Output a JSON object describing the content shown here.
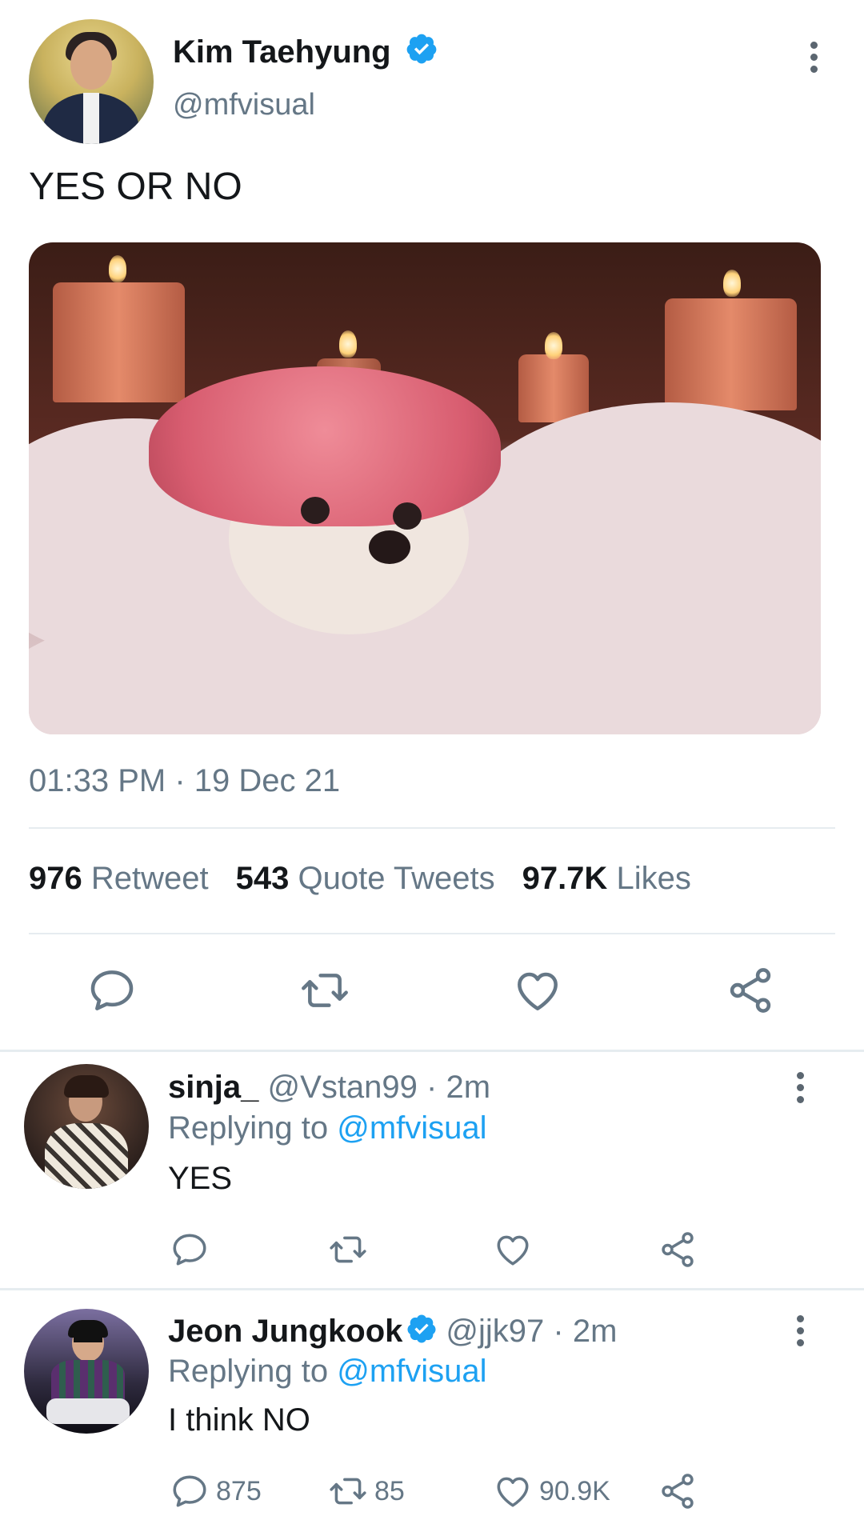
{
  "tweet": {
    "author": {
      "name": "Kim Taehyung",
      "handle": "@mfvisual",
      "verified": true
    },
    "text": "YES OR NO",
    "image_alt": "chihuahua wearing a pink shower cap in a bubble bath with candles",
    "timestamp": "01:33 PM · 19 Dec 21",
    "stats": {
      "retweets_count": "976",
      "retweets_label": "Retweet",
      "quotes_count": "543",
      "quotes_label": "Quote Tweets",
      "likes_count": "97.7K",
      "likes_label": "Likes"
    },
    "actions": [
      "reply-icon",
      "retweet-icon",
      "like-icon",
      "share-icon"
    ]
  },
  "replies": [
    {
      "name": "sinja_",
      "handle": "@Vstan99",
      "time": "· 2m",
      "verified": false,
      "replying_prefix": "Replying to",
      "replying_to": "@mfvisual",
      "text": "YES",
      "counts": {
        "reply": "",
        "retweet": "",
        "like": ""
      }
    },
    {
      "name": "Jeon Jungkook",
      "handle": "@jjk97",
      "time": "· 2m",
      "verified": true,
      "replying_prefix": "Replying to",
      "replying_to": "@mfvisual",
      "text": "I think NO",
      "counts": {
        "reply": "875",
        "retweet": "85",
        "like": "90.9K"
      }
    }
  ],
  "colors": {
    "accent": "#1da1f2",
    "text_primary": "#14171a",
    "text_secondary": "#657786",
    "divider": "#e6ecf0"
  }
}
